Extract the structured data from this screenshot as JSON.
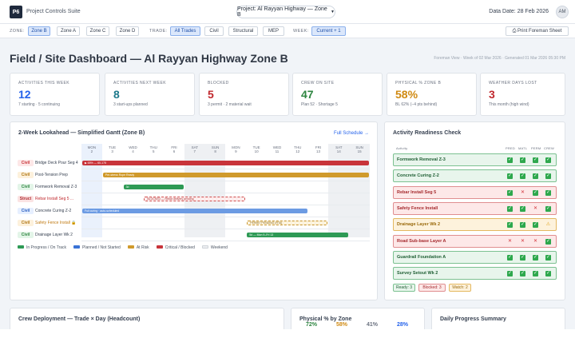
{
  "app": {
    "logo": "P6",
    "suite_name": "Project Controls Suite",
    "project_selector": "Project: Al Rayyan Highway — Zone B",
    "data_date": "Data Date: 28 Feb 2026",
    "user_initials": "AM"
  },
  "filters": {
    "zone_label": "ZONE:",
    "zones": [
      "Zone B",
      "Zone A",
      "Zone C",
      "Zone D"
    ],
    "trade_label": "TRADE:",
    "trades": [
      "All Trades",
      "Civil",
      "Structural",
      "MEP"
    ],
    "week_label": "WEEK:",
    "week_value": "Current + 1",
    "print_label": "⎙ Print Foreman Sheet"
  },
  "page": {
    "title": "Field / Site Dashboard — Al Rayyan Highway Zone B",
    "meta": "Foreman View · Week of 02 Mar 2026 · Generated 01 Mar 2026 05:30 PM"
  },
  "kpis": [
    {
      "label": "Activities This Week",
      "value": "12",
      "sub": "7 starting · 5 continuing",
      "color": "#2563eb"
    },
    {
      "label": "Activities Next Week",
      "value": "8",
      "sub": "3 start-ups planned",
      "color": "#1e7a8c"
    },
    {
      "label": "Blocked",
      "value": "5",
      "sub": "3 permit · 2 material wait",
      "color": "#c0282d"
    },
    {
      "label": "Crew on Site",
      "value": "47",
      "sub": "Plan 52 · Shortage 5",
      "color": "#2e8540"
    },
    {
      "label": "Physical % Zone B",
      "value": "58%",
      "sub": "BL 62% (−4 pts behind)",
      "color": "#d08a12"
    },
    {
      "label": "Weather Days Lost",
      "value": "3",
      "sub": "This month (high wind)",
      "color": "#c0282d"
    }
  ],
  "gantt": {
    "title": "2-Week Lookahead — Simplified Gantt (Zone B)",
    "link": "Full Schedule →",
    "days": [
      {
        "dow": "MON",
        "date": "2"
      },
      {
        "dow": "TUE",
        "date": "3"
      },
      {
        "dow": "WED",
        "date": "4"
      },
      {
        "dow": "THU",
        "date": "5"
      },
      {
        "dow": "FRI",
        "date": "6"
      },
      {
        "dow": "SAT",
        "date": "7"
      },
      {
        "dow": "SUN",
        "date": "8"
      },
      {
        "dow": "MON",
        "date": "9"
      },
      {
        "dow": "TUE",
        "date": "10"
      },
      {
        "dow": "WED",
        "date": "11"
      },
      {
        "dow": "THU",
        "date": "12"
      },
      {
        "dow": "FRI",
        "date": "13"
      },
      {
        "dow": "SAT",
        "date": "14"
      },
      {
        "dow": "SUN",
        "date": "15"
      }
    ],
    "rows": [
      {
        "trade": "Civil",
        "task": "Bridge Deck Pour Seg 4",
        "bar": "▶ 65% — 60-175",
        "start": 0,
        "span": 14,
        "status": "critical"
      },
      {
        "trade": "Civil",
        "task": "Post-Tension Prep",
        "bar": "Pre-stress Rope Ready",
        "start": 1,
        "span": 13,
        "status": "risk"
      },
      {
        "trade": "Civil",
        "task": "Formwork Removal Z-3",
        "bar": "3d",
        "start": 2,
        "span": 3,
        "status": "progress"
      },
      {
        "trade": "Struct",
        "task": "Rebar Install Seg 5 ...",
        "bar": "BLOCKED — Rebar delivery pending",
        "start": 3,
        "span": 5,
        "status": "blocked"
      },
      {
        "trade": "Civil",
        "task": "Concrete Curing Z-2",
        "bar": "Full curing · auto-scheduled",
        "start": 0,
        "span": 11,
        "status": "planned"
      },
      {
        "trade": "Civil",
        "task": "Safety Fence Install 🔒",
        "bar": "PERMIT PENDING (RTA)",
        "start": 8,
        "span": 4,
        "status": "permit"
      },
      {
        "trade": "Civil",
        "task": "Drainage Layer Wk 2",
        "bar": "5d — Mon 9–Fri 13",
        "start": 8,
        "span": 5,
        "status": "progress"
      }
    ],
    "legend": [
      {
        "label": "In Progress / On Track",
        "color": "#2e9a55"
      },
      {
        "label": "Planned / Not Started",
        "color": "#3a73d6"
      },
      {
        "label": "At Risk",
        "color": "#d09a2c"
      },
      {
        "label": "Critical / Blocked",
        "color": "#c8343a"
      },
      {
        "label": "Weekend",
        "color": "#eceef1"
      }
    ]
  },
  "readiness": {
    "title": "Activity Readiness Check",
    "headers": [
      "Activity",
      "PRED",
      "MATL",
      "PERM",
      "CREW"
    ],
    "rows": [
      {
        "name": "Formwork Removal Z-3",
        "status": "ok",
        "checks": [
          "ok",
          "ok",
          "ok",
          "ok"
        ]
      },
      {
        "name": "Concrete Curing Z-2",
        "status": "ok",
        "checks": [
          "ok",
          "ok",
          "ok",
          "ok"
        ]
      },
      {
        "name": "Rebar Install Seg 5",
        "status": "blocked",
        "checks": [
          "ok",
          "no",
          "ok",
          "ok"
        ]
      },
      {
        "name": "Safety Fence Install",
        "status": "blocked",
        "checks": [
          "ok",
          "ok",
          "no",
          "ok"
        ]
      },
      {
        "name": "Drainage Layer Wk 2",
        "status": "watch",
        "checks": [
          "ok",
          "ok",
          "ok",
          "warn"
        ]
      },
      {
        "name": "Road Sub-base Layer A",
        "status": "blocked",
        "checks": [
          "no",
          "no",
          "no",
          "ok"
        ]
      },
      {
        "name": "Guardrail Foundation A",
        "status": "ok",
        "checks": [
          "ok",
          "ok",
          "ok",
          "ok"
        ]
      },
      {
        "name": "Survey Setout Wk 2",
        "status": "ok",
        "checks": [
          "ok",
          "ok",
          "ok",
          "ok"
        ]
      }
    ],
    "summary": [
      {
        "label": "Ready: 3",
        "type": "ok"
      },
      {
        "label": "Blocked: 3",
        "type": "blocked"
      },
      {
        "label": "Watch: 2",
        "type": "watch"
      }
    ]
  },
  "bottom": {
    "crew_title": "Crew Deployment — Trade × Day (Headcount)",
    "physical_title": "Physical % by Zone",
    "physical_values": [
      {
        "value": "72%",
        "color": "#2e8540"
      },
      {
        "value": "58%",
        "color": "#d08a12"
      },
      {
        "value": "41%",
        "color": "#6b7280"
      },
      {
        "value": "28%",
        "color": "#2563eb"
      }
    ],
    "daily_title": "Daily Progress Summary"
  }
}
